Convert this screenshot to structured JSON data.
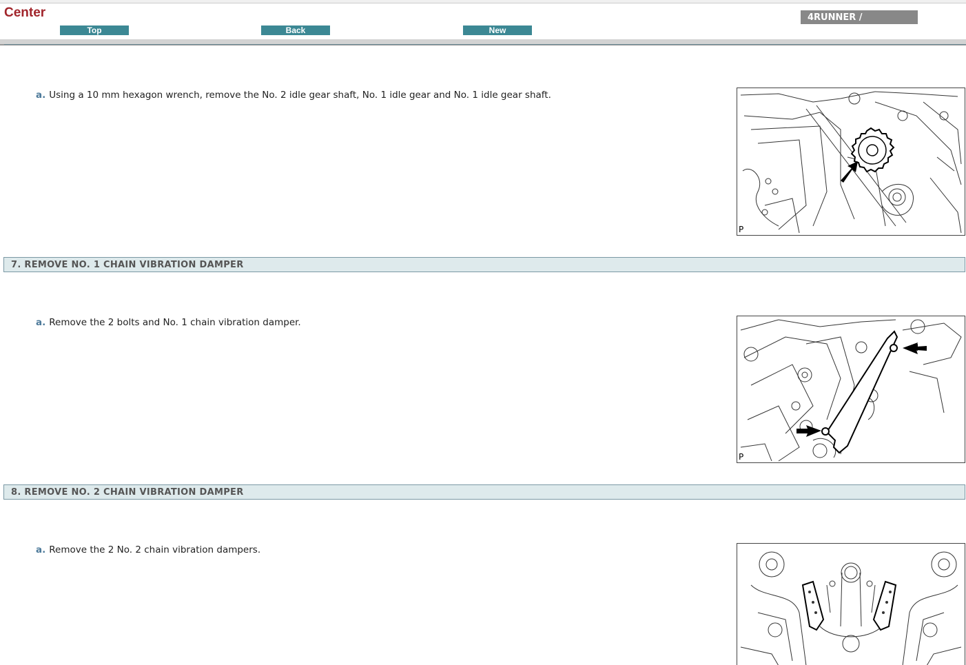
{
  "header": {
    "title": "Center",
    "nav": {
      "top": "Top",
      "back": "Back",
      "new": "New"
    },
    "model": "4RUNNER /"
  },
  "content": {
    "step6a": {
      "letter": "a.",
      "text": "Using a 10 mm hexagon wrench, remove the No. 2 idle gear shaft, No. 1 idle gear and No. 1 idle gear shaft."
    },
    "section7": {
      "title": "7. REMOVE NO. 1 CHAIN VIBRATION DAMPER"
    },
    "step7a": {
      "letter": "a.",
      "text": "Remove the 2 bolts and No. 1 chain vibration damper."
    },
    "section8": {
      "title": "8. REMOVE NO. 2 CHAIN VIBRATION DAMPER"
    },
    "step8a": {
      "letter": "a.",
      "text": "Remove the 2 No. 2 chain vibration dampers."
    }
  },
  "figures": {
    "fig1_label": "P",
    "fig2_label": "P"
  }
}
